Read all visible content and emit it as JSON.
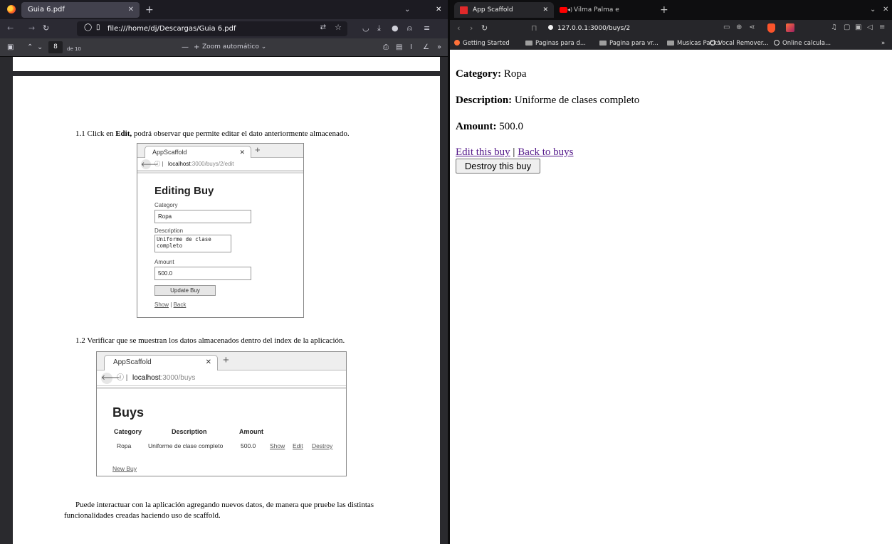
{
  "left_window": {
    "tab_title": "Guia 6.pdf",
    "url": "file:///home/dj/Descargas/Guia 6.pdf",
    "pdf_toolbar": {
      "page_number": "8",
      "page_of": "de 10",
      "zoom_label": "Zoom automático"
    },
    "document": {
      "step_1_prefix": "1.1  Click en ",
      "step_1_bold": "Edit,",
      "step_1_rest": " podrá observar que permite editar el dato anteriormente almacenado.",
      "step_2": "1.2  Verificar que se muestran los datos almacenados dentro del index de la aplicación.",
      "closing_line_1": "Puede interactuar con la aplicación agregando nuevos datos, de manera que pruebe las distintas",
      "closing_line_2": "funcionalidades creadas haciendo uso de scaffold."
    },
    "edit_screenshot": {
      "tab_title": "AppScaffold",
      "host": "localhost",
      "path": ":3000/buys/2/edit",
      "heading": "Editing Buy",
      "category_label": "Category",
      "category_value": "Ropa",
      "description_label": "Description",
      "description_value": "Uniforme de clase\ncompleto",
      "amount_label": "Amount",
      "amount_value": "500.0",
      "update_button": "Update Buy",
      "show_link": "Show",
      "sep": "|",
      "back_link": "Back"
    },
    "index_screenshot": {
      "tab_title": "AppScaffold",
      "host": "localhost",
      "path": ":3000/buys",
      "heading": "Buys",
      "columns": [
        "Category",
        "Description",
        "Amount"
      ],
      "row": {
        "category": "Ropa",
        "description": "Uniforme de clase completo",
        "amount": "500.0",
        "show": "Show",
        "edit": "Edit",
        "destroy": "Destroy"
      },
      "new_link": "New Buy"
    }
  },
  "right_window": {
    "tabs": [
      {
        "title": "App Scaffold"
      },
      {
        "title": "Vilma Palma e Vampiros"
      }
    ],
    "url": "127.0.0.1:3000/buys/2",
    "bookmarks": [
      "Getting Started",
      "Paginas para d...",
      "Pagina para vr...",
      "Musicas Packs",
      "Vocal Remover...",
      "Online calcula..."
    ],
    "page": {
      "category_label": "Category:",
      "category_value": "Ropa",
      "description_label": "Description:",
      "description_value": "Uniforme de clases completo",
      "amount_label": "Amount:",
      "amount_value": "500.0",
      "edit_link": "Edit this buy",
      "separator": "|",
      "back_link": "Back to buys",
      "destroy_button": "Destroy this buy"
    }
  }
}
